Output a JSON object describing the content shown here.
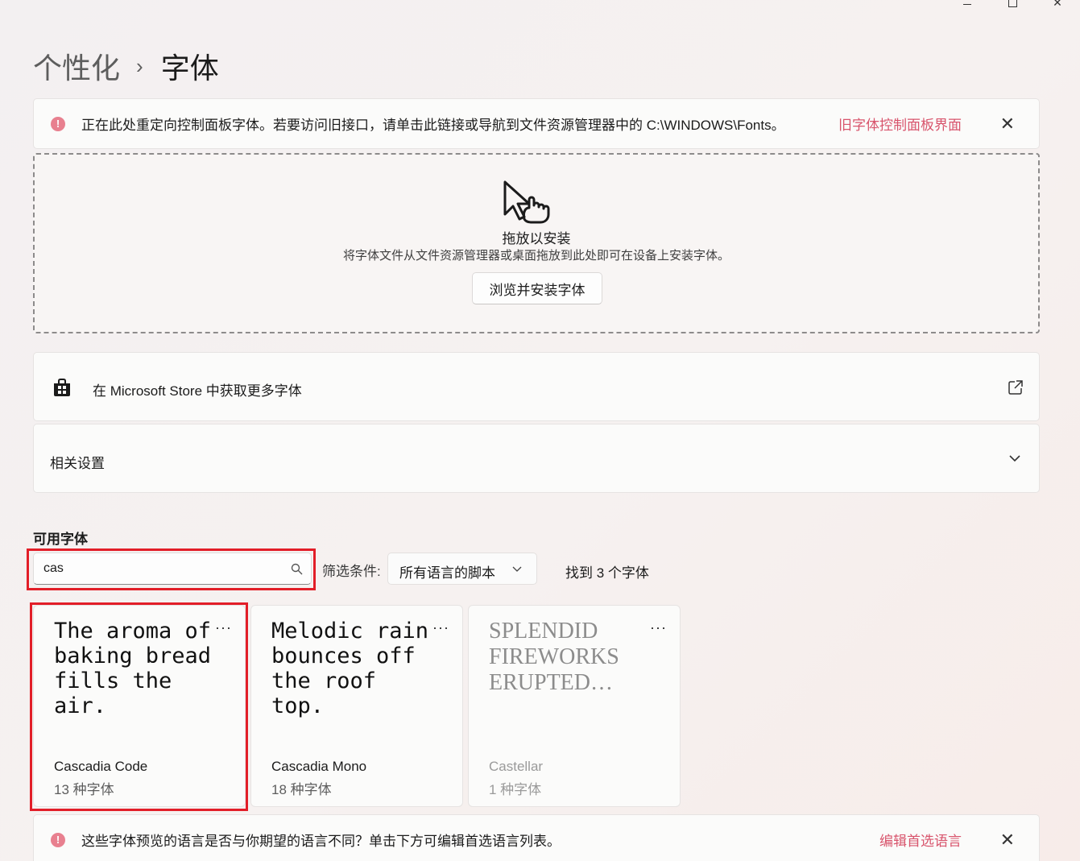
{
  "window": {
    "min_glyph": "",
    "max_glyph": "",
    "close_glyph": "✕"
  },
  "breadcrumb": {
    "parent": "个性化",
    "separator": "›",
    "current": "字体"
  },
  "info_top": {
    "icon_name": "info-icon",
    "message": "正在此处重定向控制面板字体。若要访问旧接口，请单击此链接或导航到文件资源管理器中的 C:\\WINDOWS\\Fonts。",
    "link": "旧字体控制面板界面",
    "close": "✕"
  },
  "dropzone": {
    "icon_name": "drag-hand-icon",
    "title": "拖放以安装",
    "subtitle": "将字体文件从文件资源管理器或桌面拖放到此处即可在设备上安装字体。",
    "button": "浏览并安装字体"
  },
  "store": {
    "icon_name": "store-icon",
    "label": "在 Microsoft Store 中获取更多字体",
    "ext_icon": "external-link-icon"
  },
  "related": {
    "label": "相关设置",
    "icon_name": "chevron-down-icon"
  },
  "available": {
    "title": "可用字体",
    "search": {
      "value": "cas",
      "placeholder": ""
    },
    "filter_label": "筛选条件:",
    "filter_value": "所有语言的脚本",
    "found": "找到 3 个字体"
  },
  "fonts": [
    {
      "preview": "The aroma of baking bread fills the air.",
      "name": "Cascadia Code",
      "count": "13 种字体",
      "more": "···"
    },
    {
      "preview": "Melodic rain bounces off the roof top.",
      "name": "Cascadia Mono",
      "count": "18 种字体",
      "more": "···"
    },
    {
      "preview": "SPLENDID FIREWORKS ERUPTED…",
      "name": "Castellar",
      "count": "1 种字体",
      "more": "···"
    }
  ],
  "info_bottom": {
    "icon_name": "info-icon",
    "message": "这些字体预览的语言是否与你期望的语言不同？单击下方可编辑首选语言列表。",
    "link": "编辑首选语言",
    "close": "✕"
  },
  "colors": {
    "accent_link": "#d8546c",
    "info_icon": "#e8808f",
    "highlight": "#e21e28"
  }
}
